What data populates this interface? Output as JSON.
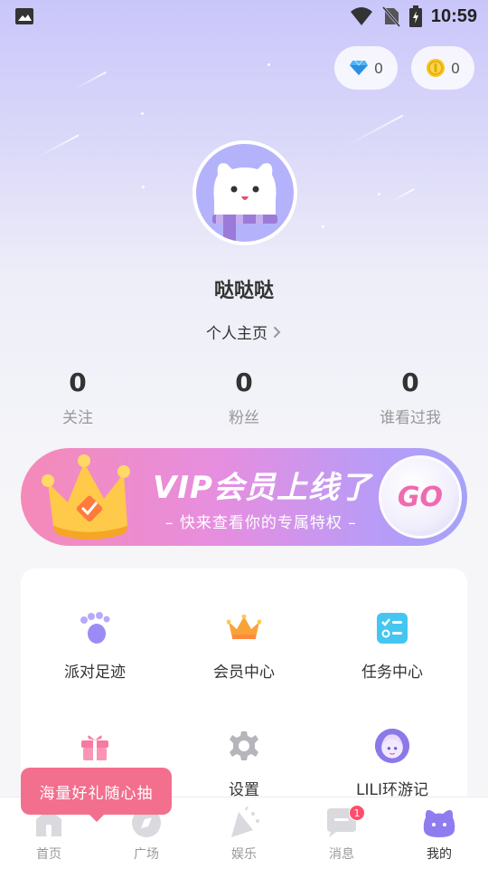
{
  "status_bar": {
    "time": "10:59",
    "icons": [
      "image-icon",
      "wifi-icon",
      "no-sim-icon",
      "battery-charging-icon"
    ]
  },
  "wallet": {
    "gems": {
      "icon": "diamond-icon",
      "count": "0"
    },
    "coins": {
      "icon": "coin-icon",
      "count": "0"
    }
  },
  "profile": {
    "avatar": "cat-avatar",
    "username": "哒哒哒",
    "homepage_label": "个人主页"
  },
  "stats": [
    {
      "value": "0",
      "label": "关注"
    },
    {
      "value": "0",
      "label": "粉丝"
    },
    {
      "value": "0",
      "label": "谁看过我"
    }
  ],
  "vip_banner": {
    "title": "VIP会员上线了",
    "subtitle": "– 快来查看你的专属特权 –",
    "go_label": "GO",
    "icon": "crown-icon"
  },
  "menu": {
    "items": [
      {
        "label": "派对足迹",
        "icon": "footprint-icon",
        "color": "#9b8cf5"
      },
      {
        "label": "会员中心",
        "icon": "crown-icon",
        "color": "#f5a84c"
      },
      {
        "label": "任务中心",
        "icon": "checklist-icon",
        "color": "#45c6f0"
      },
      {
        "label": "",
        "icon": "gift-icon",
        "color": "#f77aa0"
      },
      {
        "label": "设置",
        "icon": "gear-icon",
        "color": "#b5b5bb"
      },
      {
        "label": "LILI环游记",
        "icon": "character-avatar-icon",
        "color": "#8c79e8"
      }
    ]
  },
  "promo_tip": "海量好礼随心抽",
  "bottom_nav": {
    "tabs": [
      {
        "label": "首页",
        "icon": "home-icon",
        "active": false
      },
      {
        "label": "广场",
        "icon": "compass-icon",
        "active": false
      },
      {
        "label": "娱乐",
        "icon": "party-icon",
        "active": false
      },
      {
        "label": "消息",
        "icon": "message-icon",
        "active": false,
        "badge": "1"
      },
      {
        "label": "我的",
        "icon": "cat-face-icon",
        "active": true
      }
    ]
  },
  "colors": {
    "accent": "#8f7df0",
    "vip_pink": "#f58ab8",
    "tip_bg": "#f36f8e",
    "badge": "#ff4d6d"
  }
}
